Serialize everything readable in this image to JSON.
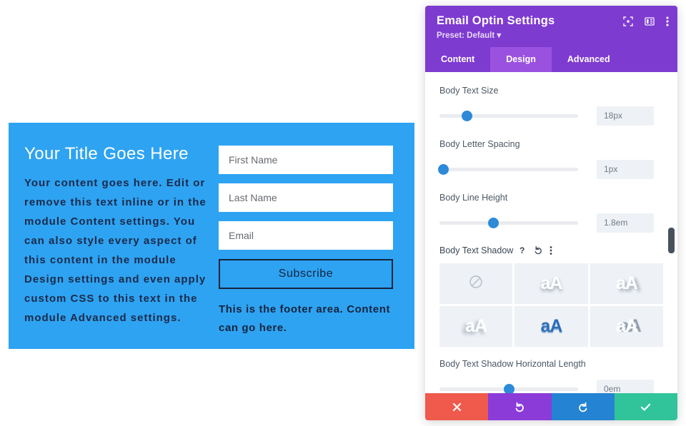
{
  "preview": {
    "title": "Your Title Goes Here",
    "body": "Your content goes here. Edit or remove this text inline or in the module Content settings. You can also style every aspect of this content in the module Design settings and even apply custom CSS to this text in the module Advanced settings.",
    "fields": [
      {
        "name": "first-name",
        "placeholder": "First Name",
        "value": ""
      },
      {
        "name": "last-name",
        "placeholder": "Last Name",
        "value": ""
      },
      {
        "name": "email",
        "placeholder": "Email",
        "value": ""
      }
    ],
    "submit_label": "Subscribe",
    "footer": "This is the footer area. Content can go here.",
    "background_color": "#2ea3f2"
  },
  "modal": {
    "title": "Email Optin Settings",
    "preset": "Preset: Default",
    "header_icons": [
      "fullscreen-icon",
      "layout-columns-icon",
      "more-vertical-icon"
    ],
    "accent_color": "#7e3bd0",
    "tabs": [
      {
        "label": "Content",
        "active": false
      },
      {
        "label": "Design",
        "active": true
      },
      {
        "label": "Advanced",
        "active": false
      }
    ],
    "controls": [
      {
        "label": "Body Text Size",
        "value": "18px",
        "handle_pct": 20
      },
      {
        "label": "Body Letter Spacing",
        "value": "1px",
        "handle_pct": 3
      },
      {
        "label": "Body Line Height",
        "value": "1.8em",
        "handle_pct": 39
      }
    ],
    "shadow": {
      "label": "Body Text Shadow",
      "help_icon": "help-icon",
      "reset_icon": "undo-icon",
      "menu_icon": "more-vertical-icon",
      "presets": [
        {
          "name": "none",
          "glyph": "",
          "selected": true
        },
        {
          "name": "shadow-bottom",
          "glyph": "aA",
          "selected": false
        },
        {
          "name": "shadow-bottom-right",
          "glyph": "aA",
          "selected": false
        },
        {
          "name": "shadow-bottom-left",
          "glyph": "aA",
          "selected": false
        },
        {
          "name": "shadow-blue",
          "glyph": "aA",
          "selected": false
        },
        {
          "name": "shadow-right-hard",
          "glyph": "aA",
          "selected": false
        }
      ]
    },
    "horizontal": {
      "label": "Body Text Shadow Horizontal Length",
      "value": "0em",
      "handle_pct": 50
    },
    "footer_buttons": [
      {
        "name": "cancel",
        "icon": "close-icon",
        "color": "#ef5a4c"
      },
      {
        "name": "undo",
        "icon": "undo-icon",
        "color": "#8b3bd8"
      },
      {
        "name": "redo",
        "icon": "redo-icon",
        "color": "#2483d2"
      },
      {
        "name": "save",
        "icon": "check-icon",
        "color": "#31c49b"
      }
    ]
  }
}
